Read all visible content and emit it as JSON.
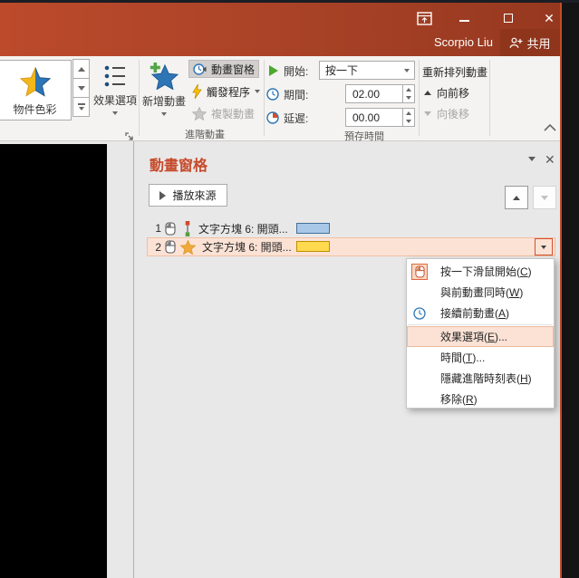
{
  "accent_color": "#B7472A",
  "titlebar": {
    "user": "Scorpio Liu",
    "share_label": "共用"
  },
  "ribbon": {
    "gallery_label": "物件色彩",
    "effect_options_label": "效果選項",
    "add_animation_label": "新增動畫",
    "animation_pane_label": "動畫窗格",
    "trigger_label": "觸發程序",
    "painter_label": "複製動畫",
    "advanced_group_label": "進階動畫",
    "timing": {
      "start_label": "開始:",
      "start_value": "按一下",
      "duration_label": "期間:",
      "duration_value": "02.00",
      "delay_label": "延遲:",
      "delay_value": "00.00",
      "group_label": "預存時間"
    },
    "reorder": {
      "title": "重新排列動畫",
      "earlier_label": "向前移",
      "later_label": "向後移"
    }
  },
  "pane": {
    "title": "動畫窗格",
    "play_button_label": "播放來源",
    "items": [
      {
        "num": "1",
        "text": "文字方塊 6: 開頭...",
        "bar_style": "background:#A9C7E7;border-color:#41719C;"
      },
      {
        "num": "2",
        "text": "文字方塊 6: 開頭...",
        "bar_style": "background:#FFD94E;border-color:#BF9000;"
      }
    ]
  },
  "menu": {
    "items": [
      {
        "pre": "按一下滑鼠開始(",
        "key": "C",
        "post": ")"
      },
      {
        "pre": "與前動畫同時(",
        "key": "W",
        "post": ")"
      },
      {
        "pre": "接續前動畫(",
        "key": "A",
        "post": ")"
      },
      {
        "pre": "效果選項(",
        "key": "E",
        "post": ")..."
      },
      {
        "pre": "時間(",
        "key": "T",
        "post": ")..."
      },
      {
        "pre": "隱藏進階時刻表(",
        "key": "H",
        "post": ")"
      },
      {
        "pre": "移除(",
        "key": "R",
        "post": ")"
      }
    ]
  }
}
